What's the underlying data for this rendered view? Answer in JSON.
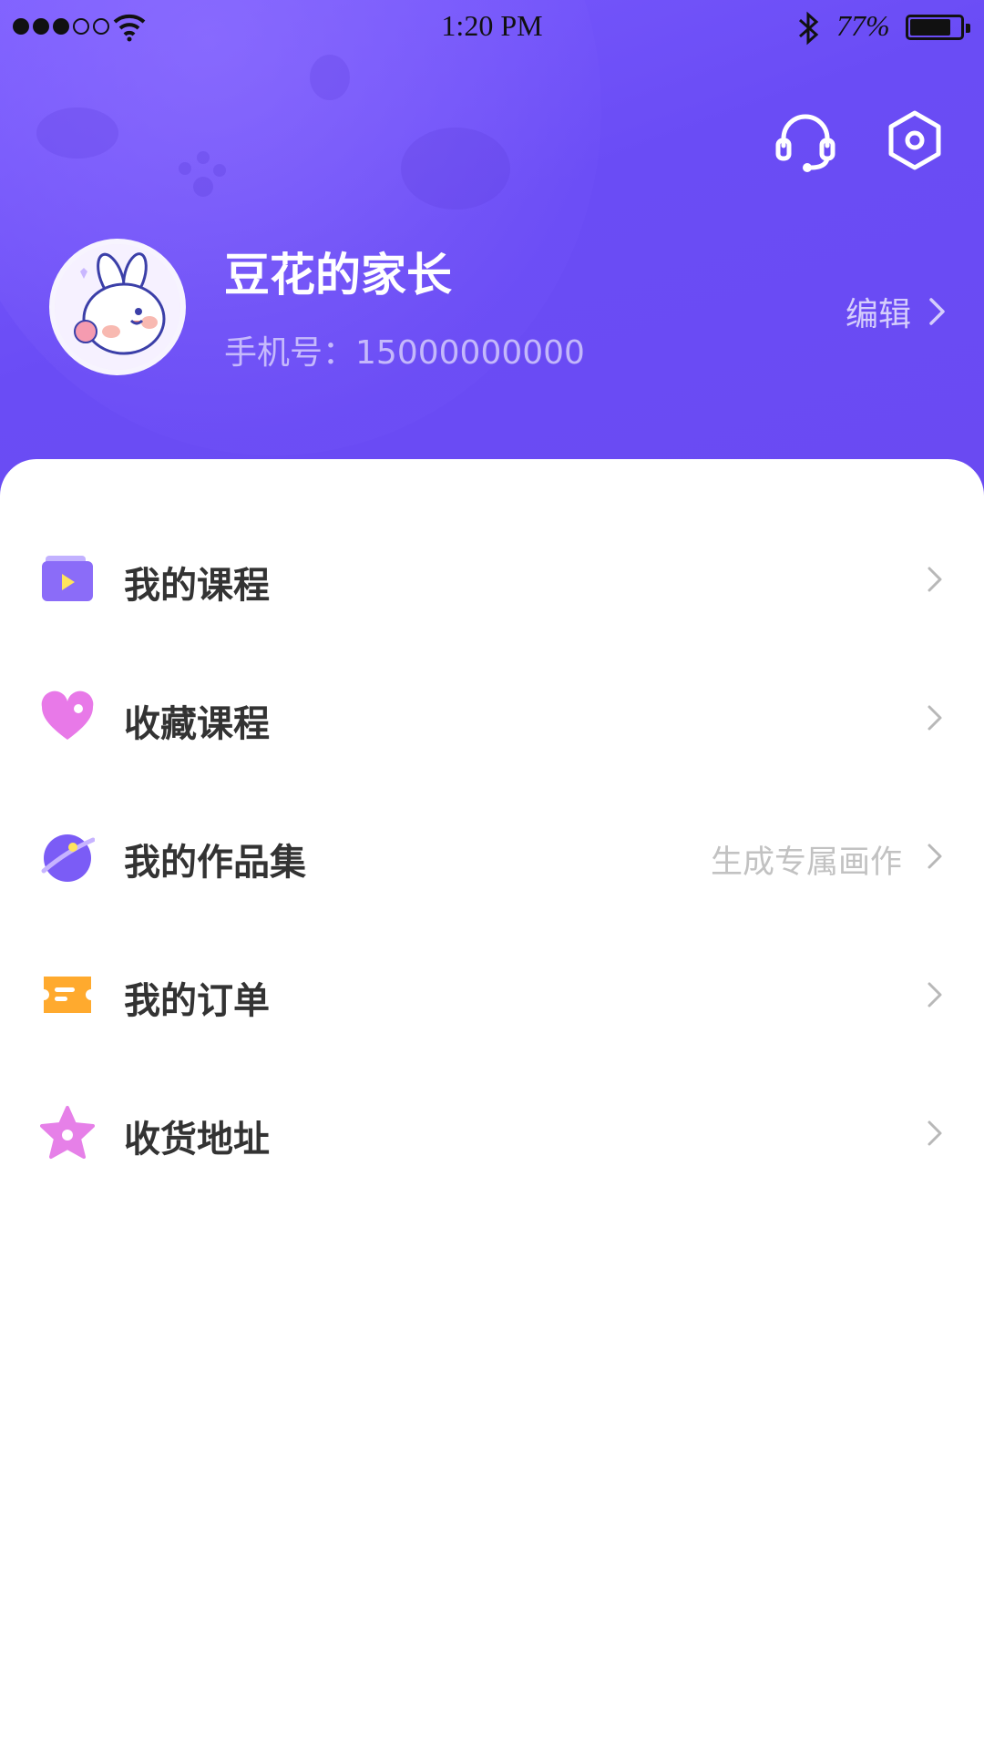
{
  "status_bar": {
    "time": "1:20 PM",
    "battery": "77%",
    "signal_bars": 3,
    "signal_total": 5,
    "icons": [
      "signal-dots",
      "wifi-icon",
      "bluetooth-icon",
      "battery-icon"
    ]
  },
  "header": {
    "icons": [
      "headset-icon",
      "settings-hex-icon"
    ],
    "avatar": "bunny-avatar",
    "user_name": "豆花的家长",
    "phone_label": "手机号：",
    "phone_number": "15000000000",
    "edit_label": "编辑"
  },
  "menu": {
    "items": [
      {
        "label": "我的课程",
        "hint": "",
        "icon": "play-folder-icon",
        "color": "#8b6cf8"
      },
      {
        "label": "收藏课程",
        "hint": "",
        "icon": "heart-icon",
        "color": "#e879e8"
      },
      {
        "label": "我的作品集",
        "hint": "生成专属画作",
        "icon": "planet-icon",
        "color": "#7b5cf6"
      },
      {
        "label": "我的订单",
        "hint": "",
        "icon": "ticket-icon",
        "color": "#ffaa2e"
      },
      {
        "label": "收货地址",
        "hint": "",
        "icon": "star-icon",
        "color": "#e680e8"
      }
    ]
  },
  "colors": {
    "header_gradient": [
      "#7b5cff",
      "#6a4af2"
    ],
    "text_primary": "#333333",
    "text_hint": "#c2c2c2"
  }
}
